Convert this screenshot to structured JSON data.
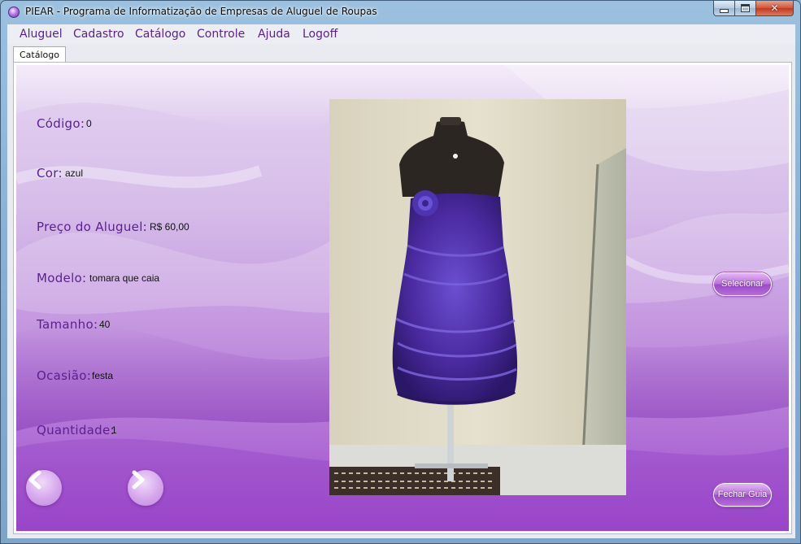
{
  "window": {
    "title": "PIEAR - Programa de Informatização de Empresas de Aluguel de Roupas",
    "close_glyph": "✕"
  },
  "menu": [
    {
      "label": "Aluguel"
    },
    {
      "label": "Cadastro"
    },
    {
      "label": "Catálogo"
    },
    {
      "label": "Controle"
    },
    {
      "label": "Ajuda"
    },
    {
      "label": "Logoff"
    }
  ],
  "tab": {
    "label": "Catálogo"
  },
  "fields": {
    "codigo": {
      "label": "Código:",
      "value": "0"
    },
    "cor": {
      "label": "Cor:",
      "value": "azul"
    },
    "preco": {
      "label": "Preço do Aluguel:",
      "value": "R$ 60,00"
    },
    "modelo": {
      "label": "Modelo:",
      "value": "tomara que caia"
    },
    "tamanho": {
      "label": "Tamanho:",
      "value": "40"
    },
    "ocasiao": {
      "label": "Ocasião:",
      "value": "festa"
    },
    "quantidade": {
      "label": "Quantidade:",
      "value": "1"
    }
  },
  "buttons": {
    "selecionar": "Selecionar",
    "fechar_guia": "Fechar Guia"
  },
  "icons": {
    "prev": "chevron-left-icon",
    "next": "chevron-right-icon",
    "app": "app-icon"
  },
  "colors": {
    "label_purple": "#5b1f8f",
    "dress_purple": "#4b2aa0",
    "button_purple": "#b873dc"
  }
}
